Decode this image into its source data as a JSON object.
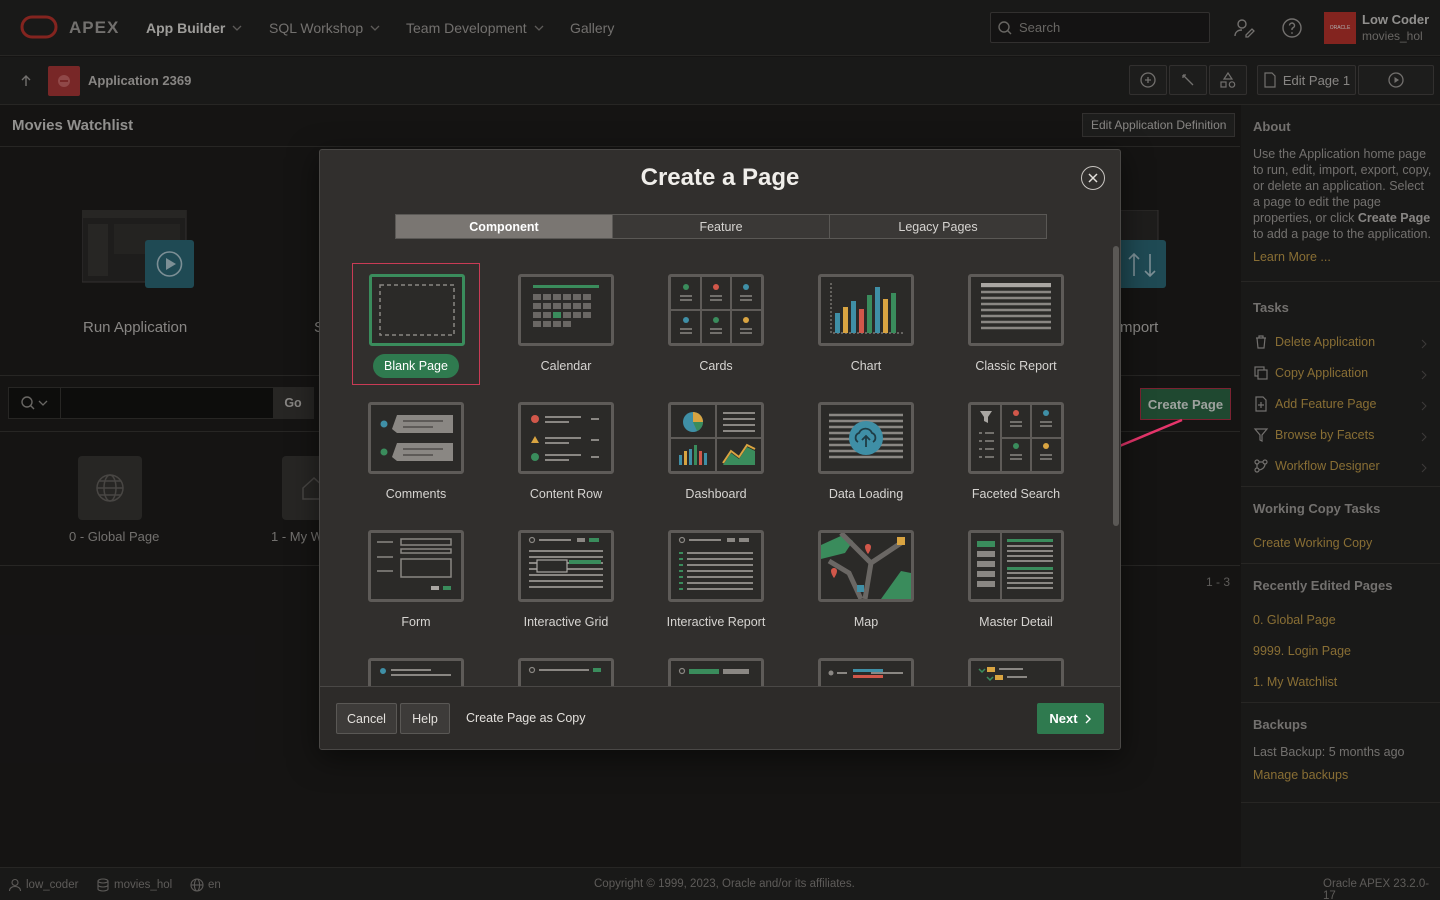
{
  "topnav": {
    "brand": "APEX",
    "items": [
      {
        "label": "App Builder"
      },
      {
        "label": "SQL Workshop"
      },
      {
        "label": "Team Development"
      },
      {
        "label": "Gallery"
      }
    ],
    "search_placeholder": "Search",
    "user_name": "Low Coder",
    "user_workspace": "movies_hol",
    "avatar_text": "ORACLE"
  },
  "appbar": {
    "app_name": "Application 2369",
    "edit_page": "Edit Page 1"
  },
  "main": {
    "title": "Movies Watchlist",
    "edit_definition": "Edit Application Definition",
    "hero_run": "Run Application",
    "hero_s": "S",
    "hero_import": "mport",
    "go_button": "Go",
    "create_page": "Create Page",
    "pages": [
      {
        "label": "0 - Global Page"
      },
      {
        "label": "1 - My Wa"
      }
    ],
    "pager": "1 - 3"
  },
  "sidebar": {
    "about_title": "About",
    "about_text_1": "Use the Application home page to run, edit, import, export, copy, or delete an application. Select a page to edit the page properties, or click ",
    "about_bold": "Create Page",
    "about_text_2": " to add a page to the application.",
    "learn_more": "Learn More ...",
    "tasks_title": "Tasks",
    "tasks": [
      {
        "label": "Delete Application",
        "icon": "trash-icon"
      },
      {
        "label": "Copy Application",
        "icon": "copy-icon"
      },
      {
        "label": "Add Feature Page",
        "icon": "add-page-icon"
      },
      {
        "label": "Browse by Facets",
        "icon": "filter-icon"
      },
      {
        "label": "Workflow Designer",
        "icon": "workflow-icon"
      }
    ],
    "wc_title": "Working Copy Tasks",
    "wc_link": "Create Working Copy",
    "recent_title": "Recently Edited Pages",
    "recent": [
      {
        "label": "0. Global Page"
      },
      {
        "label": "9999. Login Page"
      },
      {
        "label": "1. My Watchlist"
      }
    ],
    "backups_title": "Backups",
    "last_backup": "Last Backup: 5 months ago",
    "manage_backups": "Manage backups"
  },
  "footer": {
    "user": "low_coder",
    "schema": "movies_hol",
    "lang": "en",
    "copyright": "Copyright © 1999, 2023, Oracle and/or its affiliates.",
    "version": "Oracle APEX 23.2.0-17"
  },
  "dialog": {
    "title": "Create a Page",
    "tabs": [
      {
        "label": "Component",
        "active": true
      },
      {
        "label": "Feature"
      },
      {
        "label": "Legacy Pages"
      }
    ],
    "cards": [
      {
        "label": "Blank Page"
      },
      {
        "label": "Calendar"
      },
      {
        "label": "Cards"
      },
      {
        "label": "Chart"
      },
      {
        "label": "Classic Report"
      },
      {
        "label": "Comments"
      },
      {
        "label": "Content Row"
      },
      {
        "label": "Dashboard"
      },
      {
        "label": "Data Loading"
      },
      {
        "label": "Faceted Search"
      },
      {
        "label": "Form"
      },
      {
        "label": "Interactive Grid"
      },
      {
        "label": "Interactive Report"
      },
      {
        "label": "Map"
      },
      {
        "label": "Master Detail"
      }
    ],
    "cancel": "Cancel",
    "help": "Help",
    "copy_link": "Create Page as Copy",
    "next": "Next"
  },
  "colors": {
    "accent_green": "#2f7a4f",
    "link_gold": "#c9a24d",
    "selection_red": "#c93b55",
    "chart_teal": "#3f8fa6"
  }
}
